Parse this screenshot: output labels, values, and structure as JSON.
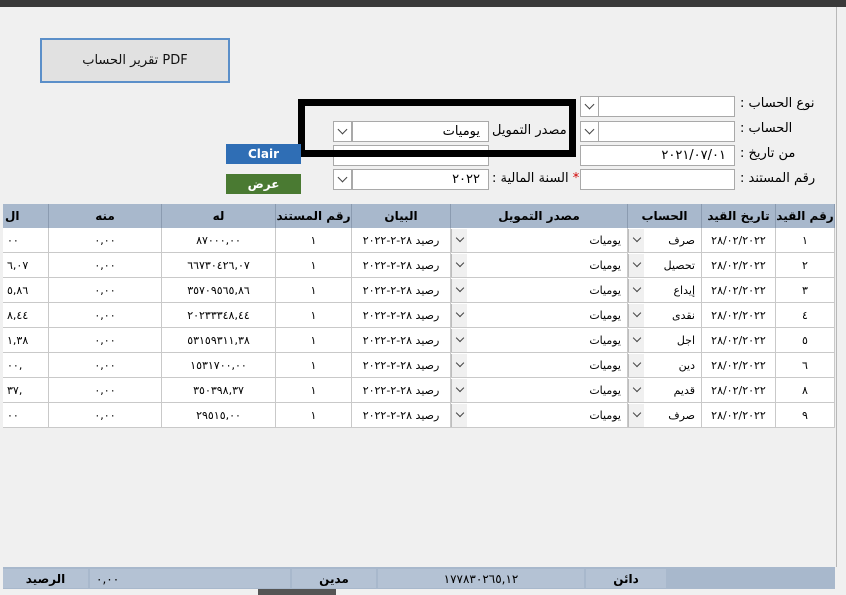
{
  "toolbar": {
    "pdf_report_label": "تقرير الحساب PDF",
    "clear_label": "Clair",
    "show_label": "عرض"
  },
  "filters": {
    "account_type_label": "نوع الحساب :",
    "account_type_value": "",
    "account_label": "الحساب :",
    "account_value": "",
    "from_date_label": "من تاريخ :",
    "from_date_value": "٢٠٢١/٠٧/٠١",
    "doc_number_label": "رقم المستند :",
    "doc_number_value": "",
    "funding_source_label": "مصدر التمويل",
    "funding_source_value": "يوميات",
    "fiscal_year_star": "*",
    "fiscal_year_label": "السنة المالية :",
    "fiscal_year_value": "٢٠٢٢"
  },
  "table": {
    "headers": {
      "entry_no": "رقم القيد",
      "entry_date": "تاريخ القيد",
      "account": "الحساب",
      "funding": "مصدر التمويل",
      "statement": "البيان",
      "doc_no": "رقم المستند",
      "credit": "له",
      "debit": "منه",
      "extra": "ال"
    },
    "rows": [
      {
        "entry_no": "١",
        "date": "٢٨/٠٢/٢٠٢٢",
        "account": "صرف",
        "funding": "يوميات",
        "statement": "رصيد ٢٨-٢-٢٠٢٢",
        "doc_no": "١",
        "credit": "٨٧٠٠٠,٠٠",
        "debit": "٠,٠٠",
        "extra": "٠٠"
      },
      {
        "entry_no": "٢",
        "date": "٢٨/٠٢/٢٠٢٢",
        "account": "تحصيل",
        "funding": "يوميات",
        "statement": "رصيد ٢٨-٢-٢٠٢٢",
        "doc_no": "١",
        "credit": "٦٦٧٣٠٤٢٦,٠٧",
        "debit": "٠,٠٠",
        "extra": "٦,٠٧"
      },
      {
        "entry_no": "٣",
        "date": "٢٨/٠٢/٢٠٢٢",
        "account": "إيداع",
        "funding": "يوميات",
        "statement": "رصيد ٢٨-٢-٢٠٢٢",
        "doc_no": "١",
        "credit": "٣٥٧٠٩٥٦٥,٨٦",
        "debit": "٠,٠٠",
        "extra": "٥,٨٦"
      },
      {
        "entry_no": "٤",
        "date": "٢٨/٠٢/٢٠٢٢",
        "account": "نقدى",
        "funding": "يوميات",
        "statement": "رصيد ٢٨-٢-٢٠٢٢",
        "doc_no": "١",
        "credit": "٢٠٢٣٣٣٤٨,٤٤",
        "debit": "٠,٠٠",
        "extra": "٨,٤٤"
      },
      {
        "entry_no": "٥",
        "date": "٢٨/٠٢/٢٠٢٢",
        "account": "اجل",
        "funding": "يوميات",
        "statement": "رصيد ٢٨-٢-٢٠٢٢",
        "doc_no": "١",
        "credit": "٥٣١٥٩٣١١,٣٨",
        "debit": "٠,٠٠",
        "extra": "١,٣٨"
      },
      {
        "entry_no": "٦",
        "date": "٢٨/٠٢/٢٠٢٢",
        "account": "دين",
        "funding": "يوميات",
        "statement": "رصيد ٢٨-٢-٢٠٢٢",
        "doc_no": "١",
        "credit": "١٥٣١٧٠٠,٠٠",
        "debit": "٠,٠٠",
        "extra": ",٠٠"
      },
      {
        "entry_no": "٨",
        "date": "٢٨/٠٢/٢٠٢٢",
        "account": "قديم",
        "funding": "يوميات",
        "statement": "رصيد ٢٨-٢-٢٠٢٢",
        "doc_no": "١",
        "credit": "٣٥٠٣٩٨,٣٧",
        "debit": "٠,٠٠",
        "extra": ",٣٧"
      },
      {
        "entry_no": "٩",
        "date": "٢٨/٠٢/٢٠٢٢",
        "account": "صرف",
        "funding": "يوميات",
        "statement": "رصيد ٢٨-٢-٢٠٢٢",
        "doc_no": "١",
        "credit": "٢٩٥١٥,٠٠",
        "debit": "٠,٠٠",
        "extra": "٠٠"
      }
    ]
  },
  "footer": {
    "creditor_label": "دائن",
    "creditor_value": "١٧٧٨٣٠٢٦٥,١٢",
    "debtor_label": "مدين",
    "debtor_value": "٠,٠٠",
    "balance_label": "الرصيد"
  },
  "colors": {
    "header_bg": "#a8b8cc",
    "clear_button": "#2f6eb5",
    "show_button": "#4a7a32",
    "required_star": "#d00000"
  }
}
